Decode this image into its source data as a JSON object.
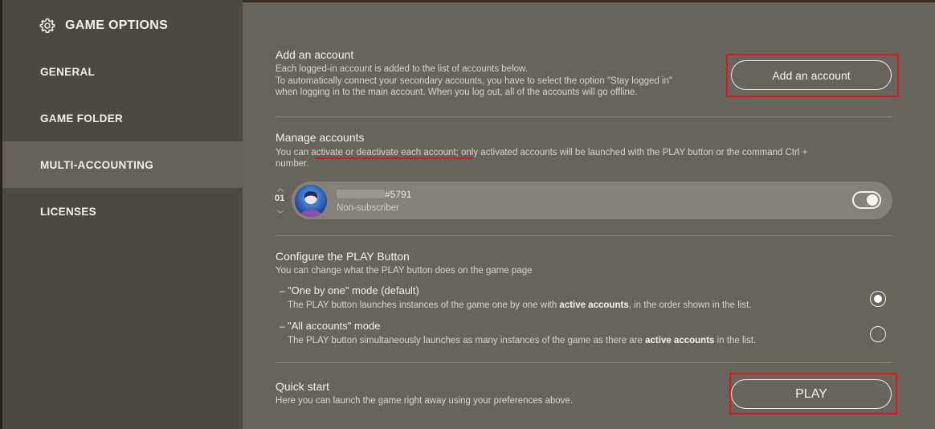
{
  "sidebar": {
    "title": "GAME OPTIONS",
    "header_icon": "gear-icon",
    "items": [
      {
        "label": "GENERAL",
        "active": false
      },
      {
        "label": "GAME FOLDER",
        "active": false
      },
      {
        "label": "MULTI-ACCOUNTING",
        "active": true
      },
      {
        "label": "LICENSES",
        "active": false
      }
    ]
  },
  "add_account": {
    "title": "Add an account",
    "desc_line1": "Each logged-in account is added to the list of accounts below.",
    "desc_line2": "To automatically connect your secondary accounts, you have to select the option \"Stay logged in\"",
    "desc_line3": "when logging in to the main account. When you log out, all of the accounts will go offline.",
    "button_label": "Add an account"
  },
  "manage": {
    "title": "Manage accounts",
    "desc_part1": "You can ",
    "desc_highlight": "activate or deactivate each account",
    "desc_part2": "; only activated accounts will be launched with the PLAY button or the command Ctrl +",
    "desc_line2": "number.",
    "account": {
      "number": "01",
      "tag": "#5791",
      "status": "Non-subscriber",
      "active": true
    }
  },
  "play_config": {
    "title": "Configure the PLAY Button",
    "desc": "You can change what the PLAY button does on the game page",
    "modes": [
      {
        "title": "\"One by one\" mode (default)",
        "desc_pre": "The PLAY button launches instances of the game one by one with ",
        "desc_bold": "active accounts",
        "desc_post": ", in the order shown in the list.",
        "selected": true
      },
      {
        "title": "\"All accounts\" mode",
        "desc_pre": "The PLAY button simultaneously launches as many instances of the game as there are ",
        "desc_bold": "active accounts",
        "desc_post": " in the list.",
        "selected": false
      }
    ]
  },
  "quick_start": {
    "title": "Quick start",
    "desc": "Here you can launch the game right away using your preferences above.",
    "button_label": "PLAY"
  },
  "colors": {
    "sidebar_bg": "#4c4943",
    "sidebar_active": "#66625b",
    "main_bg": "#68645d",
    "highlight_red": "#e0161a"
  }
}
